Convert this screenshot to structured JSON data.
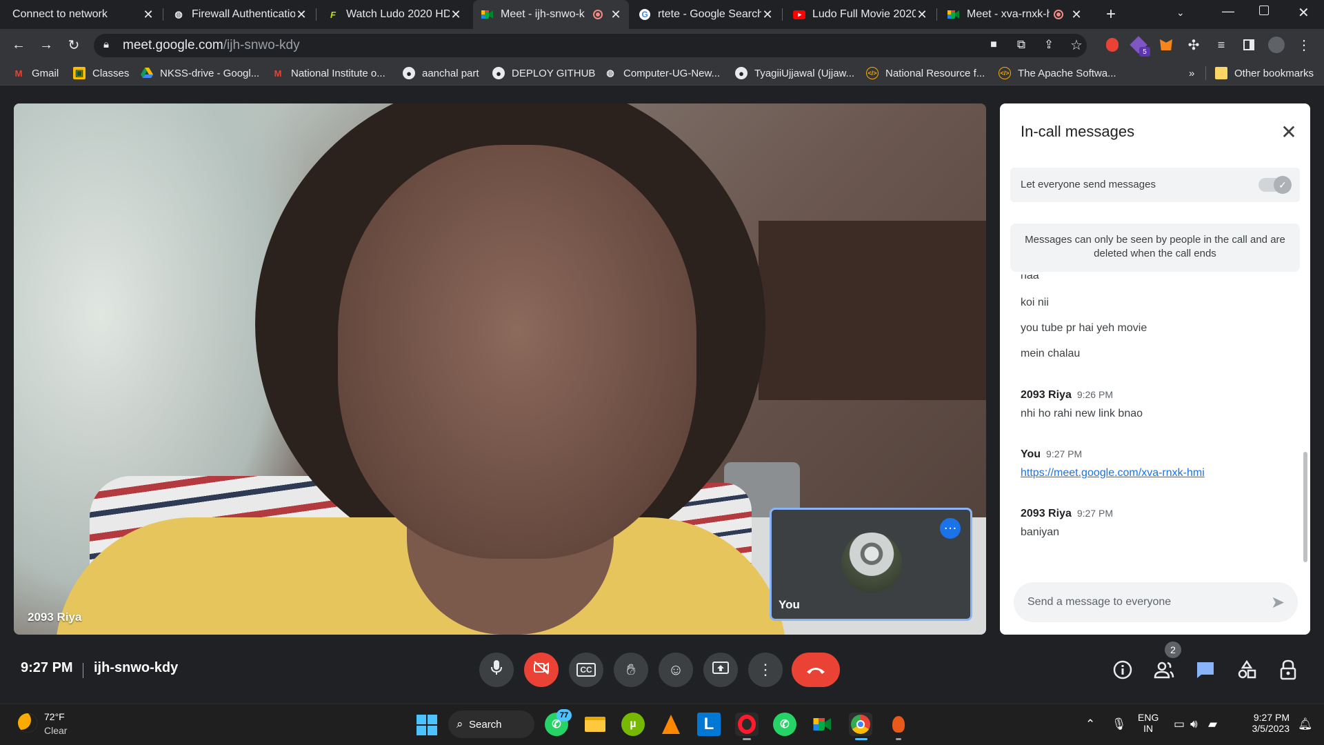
{
  "browser": {
    "tabs": [
      {
        "title": "Connect to network",
        "icon": "network-icon",
        "close": "✕"
      },
      {
        "title": "Firewall Authenticatio",
        "icon": "globe-icon",
        "close": "✕"
      },
      {
        "title": "Watch Ludo 2020 HD",
        "icon": "f-logo-icon",
        "close": "✕"
      },
      {
        "title": "Meet - ijh-snwo-k",
        "icon": "meet-icon",
        "close": "✕",
        "active": true,
        "recording": true
      },
      {
        "title": "rtete - Google Search",
        "icon": "google-icon",
        "close": "✕"
      },
      {
        "title": "Ludo Full Movie 2020",
        "icon": "youtube-icon",
        "close": "✕"
      },
      {
        "title": "Meet - xva-rnxk-h",
        "icon": "meet-icon",
        "close": "✕",
        "recording": true
      }
    ],
    "new_tab": "+",
    "url_host": "meet.google.com",
    "url_path": "/ijh-snwo-kdy",
    "bookmarks": [
      {
        "label": "Gmail",
        "icon": "gmail-icon"
      },
      {
        "label": "Classes",
        "icon": "classroom-icon"
      },
      {
        "label": "NKSS-drive - Googl...",
        "icon": "drive-icon"
      },
      {
        "label": "National Institute o...",
        "icon": "gmail-icon"
      },
      {
        "label": "aanchal part",
        "icon": "github-icon"
      },
      {
        "label": "DEPLOY GITHUB",
        "icon": "github-icon"
      },
      {
        "label": "Computer-UG-New...",
        "icon": "globe-icon"
      },
      {
        "label": "TyagiiUjjawal (Ujjaw...",
        "icon": "github-icon"
      },
      {
        "label": "National Resource f...",
        "icon": "code-icon"
      },
      {
        "label": "The Apache Softwa...",
        "icon": "code-icon"
      }
    ],
    "bookmarks_overflow": "»",
    "other_bookmarks": "Other bookmarks",
    "extension_badge": "5"
  },
  "meet": {
    "main_participant": "2093 Riya",
    "self_label": "You",
    "time": "9:27 PM",
    "meeting_code": "ijh-snwo-kdy",
    "people_count": "2"
  },
  "chat": {
    "title": "In-call messages",
    "toggle_label": "Let everyone send messages",
    "notice": "Messages can only be seen by people in the call and are deleted when the call ends",
    "input_placeholder": "Send a message to everyone",
    "partial_message": "naa",
    "messages_pre": [
      "koi nii",
      "you tube pr hai yeh movie",
      "mein chalau"
    ],
    "groups": [
      {
        "sender": "2093 Riya",
        "time": "9:26 PM",
        "text": "nhi ho rahi new link bnao"
      },
      {
        "sender": "You",
        "time": "9:27 PM",
        "link": "https://meet.google.com/xva-rnxk-hmi"
      },
      {
        "sender": "2093 Riya",
        "time": "9:27 PM",
        "text": "baniyan"
      }
    ]
  },
  "taskbar": {
    "weather_temp": "72°F",
    "weather_desc": "Clear",
    "search_label": "Search",
    "whatsapp_badge": "77",
    "lang_line1": "ENG",
    "lang_line2": "IN",
    "clock_time": "9:27 PM",
    "clock_date": "3/5/2023"
  },
  "colors": {
    "accent_blue": "#1a73e8",
    "end_call_red": "#ea4335",
    "meet_bg": "#202124"
  }
}
